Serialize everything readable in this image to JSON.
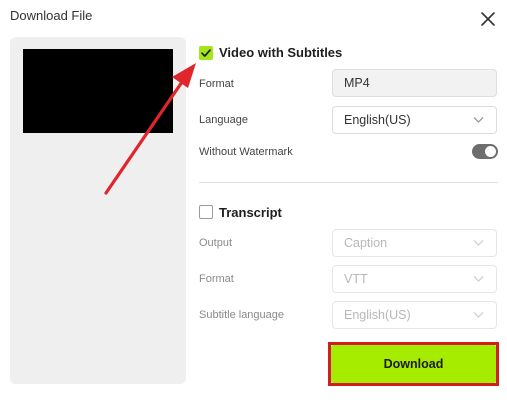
{
  "dialog": {
    "title": "Download File"
  },
  "video_subtitles": {
    "checked": true,
    "title": "Video with Subtitles",
    "format_label": "Format",
    "format_value": "MP4",
    "language_label": "Language",
    "language_value": "English(US)",
    "watermark_label": "Without Watermark",
    "watermark_on": true
  },
  "transcript": {
    "checked": false,
    "title": "Transcript",
    "output_label": "Output",
    "output_value": "Caption",
    "format_label": "Format",
    "format_value": "VTT",
    "subtitle_language_label": "Subtitle language",
    "subtitle_language_value": "English(US)"
  },
  "actions": {
    "download_label": "Download"
  },
  "colors": {
    "accent_green": "#a6ec00",
    "highlight_red": "#d11f1f"
  },
  "icons": {
    "close": "close-icon",
    "check": "checkmark-icon",
    "dropdown": "chevron-down-icon",
    "annotation": "red-arrow"
  }
}
